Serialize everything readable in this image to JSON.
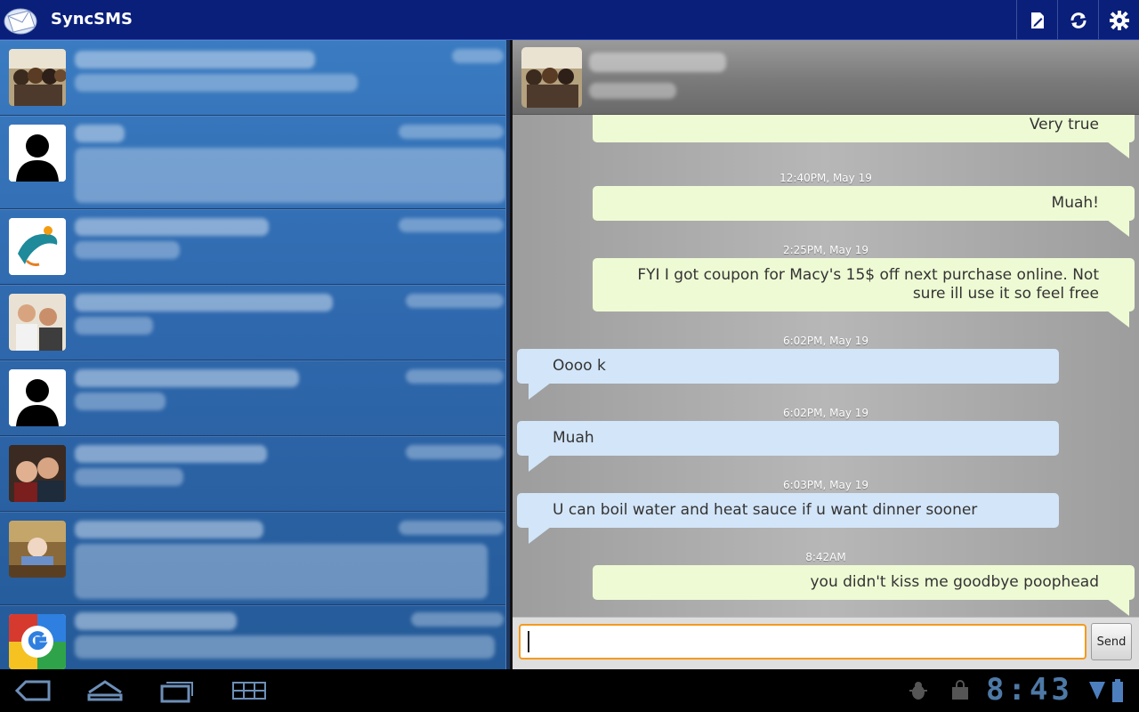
{
  "app": {
    "title": "SyncSMS"
  },
  "toolbar": {
    "compose_icon": "compose-icon",
    "refresh_icon": "refresh-icon",
    "settings_icon": "gear-icon"
  },
  "conversations": [
    {
      "avatar": "photo"
    },
    {
      "avatar": "placeholder-silhouette"
    },
    {
      "avatar": "dolphin-logo"
    },
    {
      "avatar": "photo"
    },
    {
      "avatar": "placeholder-silhouette"
    },
    {
      "avatar": "photo"
    },
    {
      "avatar": "photo"
    },
    {
      "avatar": "google-logo"
    }
  ],
  "thread": {
    "messages": [
      {
        "type": "out",
        "text": "Very true"
      },
      {
        "type": "time",
        "text": "12:40PM, May 19"
      },
      {
        "type": "out",
        "text": "Muah!"
      },
      {
        "type": "time",
        "text": "2:25PM, May 19"
      },
      {
        "type": "out",
        "text": "FYI I got coupon for Macy's 15$ off next purchase online. Not sure ill use it so feel free"
      },
      {
        "type": "time",
        "text": "6:02PM, May 19"
      },
      {
        "type": "in",
        "text": "Oooo k"
      },
      {
        "type": "time",
        "text": "6:02PM, May 19"
      },
      {
        "type": "in",
        "text": "Muah"
      },
      {
        "type": "time",
        "text": "6:03PM, May 19"
      },
      {
        "type": "in",
        "text": "U can boil water and heat sauce if u want dinner sooner"
      },
      {
        "type": "time",
        "text": "8:42AM"
      },
      {
        "type": "out",
        "text": "you didn't kiss me goodbye poophead"
      }
    ],
    "compose": {
      "value": "",
      "send_label": "Send"
    }
  },
  "system": {
    "clock": "8:43"
  },
  "colors": {
    "title_bar": "#0a1f7a",
    "outgoing_bubble": "#eefad4",
    "incoming_bubble": "#d3e5f8",
    "input_focus": "#f49a1e"
  }
}
